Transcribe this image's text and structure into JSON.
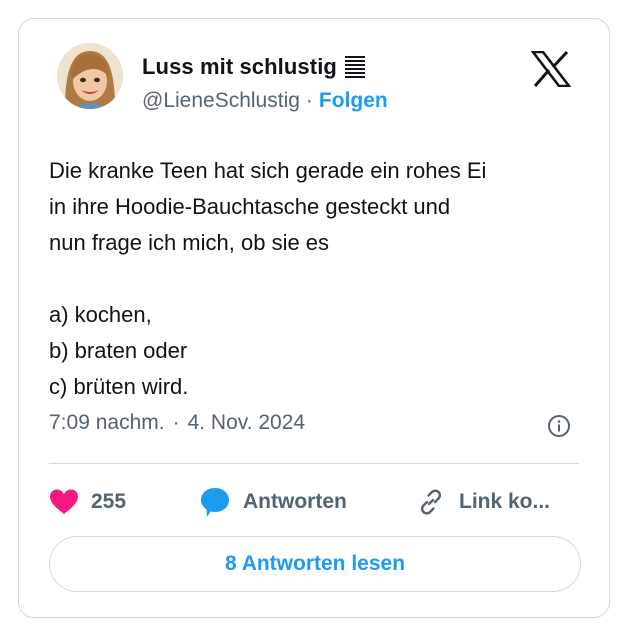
{
  "author": {
    "display_name": "Luss mit schlustig",
    "handle": "@LieneSchlustig",
    "separator": "·",
    "follow_label": "Folgen"
  },
  "tweet": {
    "text": "Die kranke Teen hat sich gerade ein rohes Ei\nin ihre Hoodie-Bauchtasche gesteckt und\nnun frage ich mich, ob sie es\n\na) kochen,\nb) braten oder\nc) brüten wird.",
    "time": "7:09 nachm.",
    "separator": "·",
    "date": "4. Nov. 2024"
  },
  "actions": {
    "like_count": "255",
    "reply_label": "Antworten",
    "copy_link_label": "Link ko..."
  },
  "read_replies_label": "8 Antworten lesen",
  "icons": {
    "like": "heart-icon",
    "reply": "speech-bubble-icon",
    "link": "link-icon",
    "info": "info-icon",
    "brand": "x-logo-icon",
    "badge": "stack-lines-icon"
  },
  "colors": {
    "accent": "#1d9bf0",
    "like": "#f91880",
    "text": "#0f1419",
    "muted": "#536471",
    "border": "#cfd9de"
  }
}
